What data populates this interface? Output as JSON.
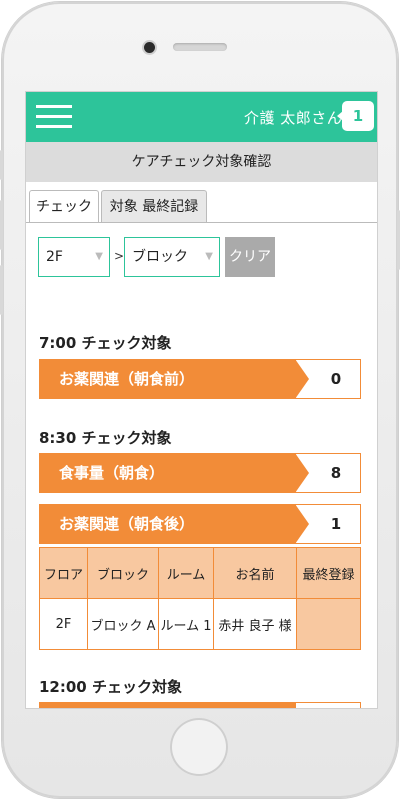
{
  "header": {
    "menu_icon": "hamburger-menu-icon",
    "user_name": "介護 太郎さん",
    "notification_count": "1"
  },
  "subheader": {
    "title": "ケアチェック対象確認"
  },
  "tabs": [
    {
      "label": "チェック",
      "active": true
    },
    {
      "label": "対象 最終記録",
      "active": false
    }
  ],
  "filters": {
    "floor_value": "2F",
    "separator": ">",
    "block_value": "ブロック",
    "clear_label": "クリア"
  },
  "sections": [
    {
      "title": "7:00 チェック対象",
      "rows": [
        {
          "label": "お薬関連（朝食前）",
          "count": "0"
        }
      ]
    },
    {
      "title": "8:30 チェック対象",
      "rows": [
        {
          "label": "食事量（朝食）",
          "count": "8"
        },
        {
          "label": "お薬関連（朝食後）",
          "count": "1"
        }
      ]
    },
    {
      "title": "12:00 チェック対象",
      "rows": []
    }
  ],
  "table": {
    "headers": [
      "フロア",
      "ブロック",
      "ルーム",
      "お名前",
      "最終登録"
    ],
    "rows": [
      [
        "2F",
        "ブロック A",
        "ルーム 1",
        "赤井 良子 様",
        ""
      ]
    ]
  },
  "colors": {
    "accent_green": "#2dc49a",
    "accent_orange": "#f28c38",
    "light_orange": "#f8c8a0"
  }
}
